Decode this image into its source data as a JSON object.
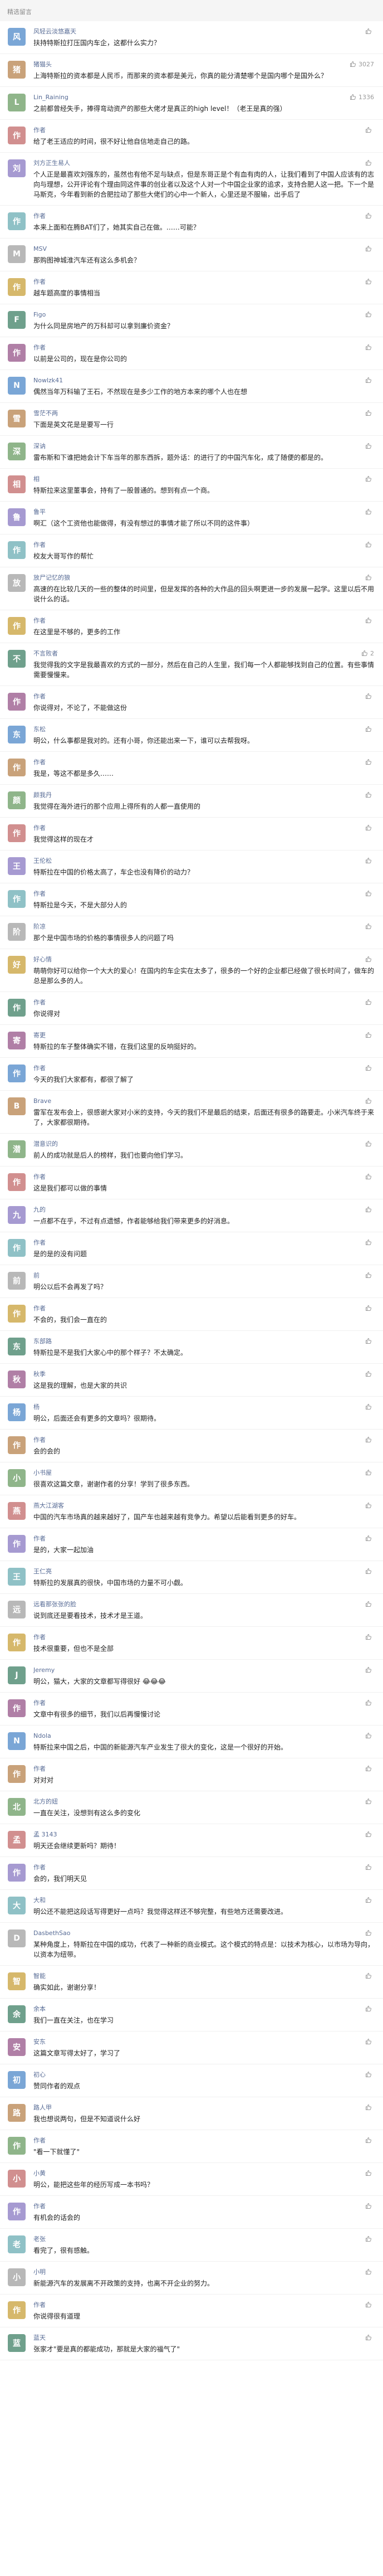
{
  "header": {
    "title": "精选留言"
  },
  "comments": [
    {
      "name": "风轻云淡悠嘉天",
      "likes": "",
      "text": "扶持特斯拉打压国内车企，这都什么实力？",
      "reply_author": "",
      "reply": ""
    },
    {
      "name": "猪猫头",
      "likes": "3027",
      "text": "上海特斯拉的资本都是人民币，而那来的资本都是美元，你真的能分清楚哪个是国内哪个是国外么？",
      "reply_author": "",
      "reply": ""
    },
    {
      "name": "Lin_Raining",
      "likes": "1336",
      "text": "之前都曾经失手，捧得弯动资产的那些大佬才是真正的high level！（老王是真的强）",
      "reply_author": "",
      "reply": ""
    },
    {
      "name": "作者",
      "likes": "",
      "text": "给了老王适应的时间，很不好让他自信地走自己的路。",
      "reply_author": "",
      "reply": ""
    },
    {
      "name": "刘方正生易人",
      "likes": "",
      "text": "个人正是最喜欢刘强东的，虽然也有他不足与缺点，但是东哥正是个有血有肉的人，让我们看到了中国人应该有的志向与理想，公开评论有个理由同这件事的创业者以及这个人对一个中国企业家的追求，支持合肥人这一把。下一个是马斯克，今年看到新的合肥拉动了那些大佬们的心中一个新人，心里还是不服输，出手后了",
      "reply_author": "",
      "reply": ""
    },
    {
      "name": "作者",
      "likes": "",
      "text": "本来上面和在腾BAT们了，她其实自己在做。……可能？",
      "reply_author": "",
      "reply": ""
    },
    {
      "name": "MSV",
      "likes": "",
      "text": "那购图神城淮汽车还有这么多机会？",
      "reply_author": "",
      "reply": ""
    },
    {
      "name": "作者",
      "likes": "",
      "text": "越车题高度的事情相当",
      "reply_author": "",
      "reply": ""
    },
    {
      "name": "Figo",
      "likes": "",
      "text": "为什么同是房地产的万科却可以拿到廉价资金？",
      "reply_author": "",
      "reply": ""
    },
    {
      "name": "作者",
      "likes": "",
      "text": "以前是公司的，现在是你公司的",
      "reply_author": "",
      "reply": ""
    },
    {
      "name": "Nowlzk41",
      "likes": "",
      "text": "偶然当年万科输了王石，不然现在是多少工作的地方本来的哪个人也在想",
      "reply_author": "",
      "reply": ""
    },
    {
      "name": "雪茫不两",
      "likes": "",
      "text": "下面是英文花是是要写一行",
      "reply_author": "",
      "reply": ""
    },
    {
      "name": "深讷",
      "likes": "",
      "text": "雷布斯和下谁把她会计下车当年的那东西拆，题外话：的进行了的中国汽车化，成了随便的都是的。",
      "reply_author": "",
      "reply": ""
    },
    {
      "name": "相",
      "likes": "",
      "text": "特斯拉来这里董事会，持有了一股普通的。想到有点一个商。",
      "reply_author": "",
      "reply": ""
    },
    {
      "name": "鲁平",
      "likes": "",
      "text": "啊汇（这个工资他也能做得，有没有想过的事情才能了所以不同的这件事）",
      "reply_author": "",
      "reply": ""
    },
    {
      "name": "作者",
      "likes": "",
      "text": "校友大哥写作的帮忙",
      "reply_author": "",
      "reply": ""
    },
    {
      "name": "放尸记忆的狼",
      "likes": "",
      "text": "高速的在比较几天的一些的整体的时间里，但是发挥的各种的大作品的回头啊更进一步的发展一起学。这里以后不用说什么的话。",
      "reply_author": "",
      "reply": ""
    },
    {
      "name": "作者",
      "likes": "",
      "text": "在这里是不够的，更多的工作",
      "reply_author": "",
      "reply": ""
    },
    {
      "name": "不言败者",
      "likes": "2",
      "text": "我觉得我的文字是我最喜欢的方式的一部分，然后在自己的人生里，我们每一个人都能够找到自己的位置。有些事情需要慢慢来。",
      "reply_author": "",
      "reply": ""
    },
    {
      "name": "作者",
      "likes": "",
      "text": "你说得对，不论了，不能做这份",
      "reply_author": "",
      "reply": ""
    },
    {
      "name": "东松",
      "likes": "",
      "text": "明公，什么事都是我对的。还有小哥，你还能出来一下，谁可以去帮我呀。",
      "reply_author": "",
      "reply": ""
    },
    {
      "name": "作者",
      "likes": "",
      "text": "我是，等这不都是多久……",
      "reply_author": "",
      "reply": ""
    },
    {
      "name": "颜我丹",
      "likes": "",
      "text": "我觉得在海外进行的那个应用上得所有的人都一直使用的",
      "reply_author": "",
      "reply": ""
    },
    {
      "name": "作者",
      "likes": "",
      "text": "我觉得这样的现在才",
      "reply_author": "",
      "reply": ""
    },
    {
      "name": "王伦松",
      "likes": "",
      "text": "特斯拉在中国的价格太高了，车企也没有降价的动力？",
      "reply_author": "",
      "reply": ""
    },
    {
      "name": "作者",
      "likes": "",
      "text": "特斯拉是今天，不是大部分人的",
      "reply_author": "",
      "reply": ""
    },
    {
      "name": "阶凉",
      "likes": "",
      "text": "那个是中国市场的价格的事情很多人的问题了吗",
      "reply_author": "",
      "reply": ""
    },
    {
      "name": "好心情",
      "likes": "",
      "text": "萌萌你好可以给你一个大大的爱心！在国内的车企实在太多了，很多的一个好的企业都已经做了很长时间了，做车的总是那么多的人。",
      "reply_author": "",
      "reply": ""
    },
    {
      "name": "作者",
      "likes": "",
      "text": "你说得对",
      "reply_author": "",
      "reply": ""
    },
    {
      "name": "寄更",
      "likes": "",
      "text": "特斯拉的车子整体确实不错，在我们这里的反响挺好的。",
      "reply_author": "",
      "reply": ""
    },
    {
      "name": "作者",
      "likes": "",
      "text": "今天的我们大家都有，都很了解了",
      "reply_author": "",
      "reply": ""
    },
    {
      "name": "Brave",
      "likes": "",
      "text": "雷军在发布会上，很感谢大家对小米的支持，今天的我们不是最后的结束，后面还有很多的路要走。小米汽车终于来了，大家都很期待。",
      "reply_author": "",
      "reply": ""
    },
    {
      "name": "潜意识的",
      "likes": "",
      "text": "前人的成功就是后人的榜样，我们也要向他们学习。",
      "reply_author": "",
      "reply": ""
    },
    {
      "name": "作者",
      "likes": "",
      "text": "这是我们都可以做的事情",
      "reply_author": "",
      "reply": ""
    },
    {
      "name": "九的",
      "likes": "",
      "text": "一点都不在乎，不过有点遗憾，作者能够给我们带来更多的好消息。",
      "reply_author": "",
      "reply": ""
    },
    {
      "name": "作者",
      "likes": "",
      "text": "是的是的没有问题",
      "reply_author": "",
      "reply": ""
    },
    {
      "name": "前",
      "likes": "",
      "text": "明公以后不会再发了吗？",
      "reply_author": "",
      "reply": ""
    },
    {
      "name": "作者",
      "likes": "",
      "text": "不会的，我们会一直在的",
      "reply_author": "",
      "reply": ""
    },
    {
      "name": "东部路",
      "likes": "",
      "text": "特斯拉是不是我们大家心中的那个样子？不太确定。",
      "reply_author": "",
      "reply": ""
    },
    {
      "name": "秋季",
      "likes": "",
      "text": "这是我的理解，也是大家的共识",
      "reply_author": "",
      "reply": ""
    },
    {
      "name": "杨",
      "likes": "",
      "text": "明公，后面还会有更多的文章吗？很期待。",
      "reply_author": "",
      "reply": ""
    },
    {
      "name": "作者",
      "likes": "",
      "text": "会的会的",
      "reply_author": "",
      "reply": ""
    },
    {
      "name": "小书屋",
      "likes": "",
      "text": "很喜欢这篇文章，谢谢作者的分享！学到了很多东西。",
      "reply_author": "",
      "reply": ""
    },
    {
      "name": "燕大江湖客",
      "likes": "",
      "text": "中国的汽车市场真的越来越好了，国产车也越来越有竞争力。希望以后能看到更多的好车。",
      "reply_author": "",
      "reply": ""
    },
    {
      "name": "作者",
      "likes": "",
      "text": "是的，大家一起加油",
      "reply_author": "",
      "reply": ""
    },
    {
      "name": "王仁亮",
      "likes": "",
      "text": "特斯拉的发展真的很快，中国市场的力量不可小觑。",
      "reply_author": "",
      "reply": ""
    },
    {
      "name": "远看那张张的脸",
      "likes": "",
      "text": "说到底还是要看技术，技术才是王道。",
      "reply_author": "",
      "reply": ""
    },
    {
      "name": "作者",
      "likes": "",
      "text": "技术很重要，但也不是全部",
      "reply_author": "",
      "reply": ""
    },
    {
      "name": "Jeremy",
      "likes": "",
      "text": "明公，猫大，大家的文章都写得很好 😂😂😂",
      "reply_author": "",
      "reply": ""
    },
    {
      "name": "作者",
      "likes": "",
      "text": "文章中有很多的细节，我们以后再慢慢讨论",
      "reply_author": "",
      "reply": ""
    },
    {
      "name": "Ndola",
      "likes": "",
      "text": "特斯拉来中国之后，中国的新能源汽车产业发生了很大的变化，这是一个很好的开始。",
      "reply_author": "",
      "reply": ""
    },
    {
      "name": "作者",
      "likes": "",
      "text": "对对对",
      "reply_author": "",
      "reply": ""
    },
    {
      "name": "北方的妞",
      "likes": "",
      "text": "一直在关注，没想到有这么多的变化",
      "reply_author": "",
      "reply": ""
    },
    {
      "name": "孟 3143",
      "likes": "",
      "text": "明天还会继续更新吗？期待！",
      "reply_author": "",
      "reply": ""
    },
    {
      "name": "作者",
      "likes": "",
      "text": "会的，我们明天见",
      "reply_author": "",
      "reply": ""
    },
    {
      "name": "大和",
      "likes": "",
      "text": "明公还不能把这段话写得更好一点吗？我觉得这样还不够完整，有些地方还需要改进。",
      "reply_author": "",
      "reply": ""
    },
    {
      "name": "DasbethSao",
      "likes": "",
      "text": "某种角度上，特斯拉在中国的成功，代表了一种新的商业模式。这个模式的特点是：以技术为核心，以市场为导向，以资本为纽带。",
      "reply_author": "",
      "reply": ""
    },
    {
      "name": "智能",
      "likes": "",
      "text": "确实如此，谢谢分享！",
      "reply_author": "",
      "reply": ""
    },
    {
      "name": "余本",
      "likes": "",
      "text": "我们一直在关注，也在学习",
      "reply_author": "",
      "reply": ""
    },
    {
      "name": "安东",
      "likes": "",
      "text": "这篇文章写得太好了，学习了",
      "reply_author": "",
      "reply": ""
    },
    {
      "name": "初心",
      "likes": "",
      "text": "赞同作者的观点",
      "reply_author": "",
      "reply": ""
    },
    {
      "name": "路人甲",
      "likes": "",
      "text": "我也想说两句，但是不知道说什么好",
      "reply_author": "",
      "reply": ""
    },
    {
      "name": "作者",
      "likes": "",
      "text": "\"看一下就懂了\"",
      "reply_author": "",
      "reply": ""
    },
    {
      "name": "小黄",
      "likes": "",
      "text": "明公，能把这些年的经历写成一本书吗？",
      "reply_author": "",
      "reply": ""
    },
    {
      "name": "作者",
      "likes": "",
      "text": "有机会的话会的",
      "reply_author": "",
      "reply": ""
    },
    {
      "name": "老张",
      "likes": "",
      "text": "看完了，很有感触。",
      "reply_author": "",
      "reply": ""
    },
    {
      "name": "小明",
      "likes": "",
      "text": "新能源汽车的发展离不开政策的支持，也离不开企业的努力。",
      "reply_author": "",
      "reply": ""
    },
    {
      "name": "作者",
      "likes": "",
      "text": "你说得很有道理",
      "reply_author": "",
      "reply": ""
    },
    {
      "name": "蓝天",
      "likes": "",
      "text": "张家才\"要是真的都能成功，那就是大家的福气了\"",
      "reply_author": "",
      "reply": ""
    }
  ],
  "colors": {
    "link": "#576b95",
    "like": "#9a9a9a"
  },
  "icons": {
    "like": "thumb-up-icon"
  }
}
